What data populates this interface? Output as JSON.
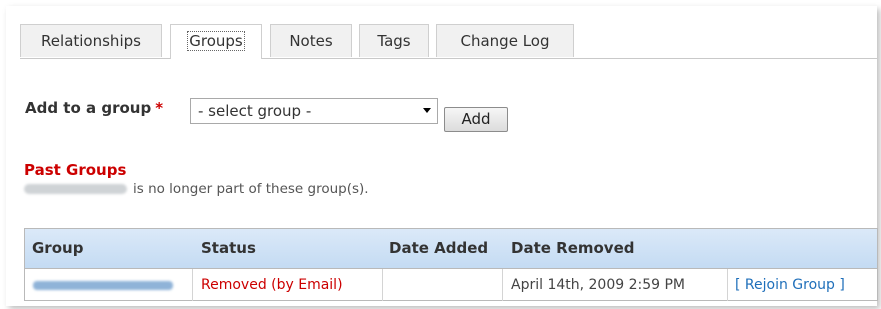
{
  "tabs": [
    {
      "label": "Relationships",
      "active": false
    },
    {
      "label": "Groups",
      "active": true
    },
    {
      "label": "Notes",
      "active": false
    },
    {
      "label": "Tags",
      "active": false
    },
    {
      "label": "Change Log",
      "active": false
    }
  ],
  "add_group": {
    "label": "Add to a group",
    "required_marker": "*",
    "select_value": "- select group -",
    "button_label": "Add"
  },
  "past_groups": {
    "title": "Past Groups",
    "description_suffix": "is no longer part of these group(s)."
  },
  "table": {
    "headers": [
      "Group",
      "Status",
      "Date Added",
      "Date Removed",
      ""
    ],
    "rows": [
      {
        "status": "Removed (by Email)",
        "date_added": "",
        "date_removed": "April 14th, 2009 2:59 PM",
        "action": "[ Rejoin Group ]"
      }
    ]
  },
  "colors": {
    "required": "#cc0000",
    "past_title": "#cc0000",
    "header_bg": "#c4dbf3",
    "link": "#1f6fba"
  }
}
